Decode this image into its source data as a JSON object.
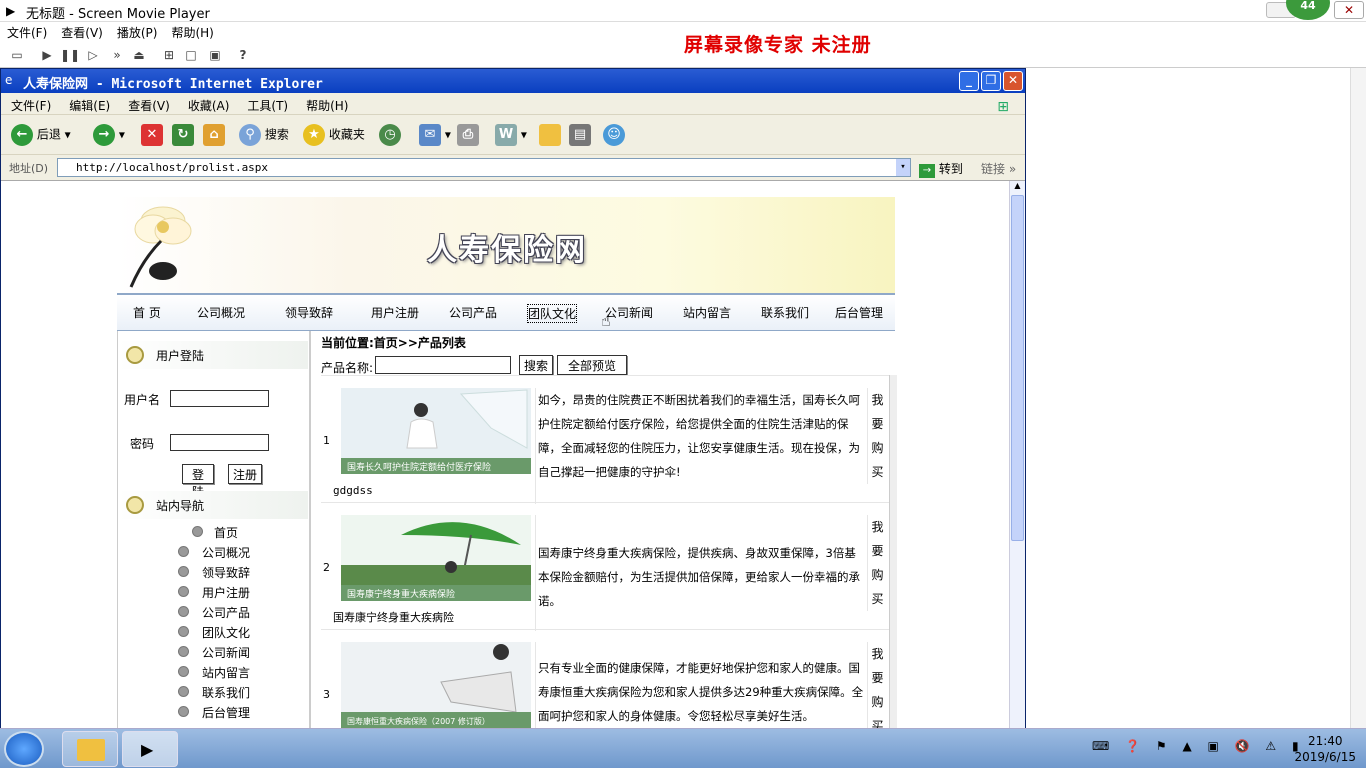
{
  "player": {
    "title": "无标题 - Screen Movie Player",
    "menu": [
      "文件(F)",
      "查看(V)",
      "播放(P)",
      "帮助(H)"
    ],
    "watermark": "屏幕录像专家  未注册",
    "badge": "44"
  },
  "ie": {
    "title": "人寿保险网 - Microsoft Internet Explorer",
    "menu": [
      "文件(F)",
      "编辑(E)",
      "查看(V)",
      "收藏(A)",
      "工具(T)",
      "帮助(H)"
    ],
    "toolbar": {
      "back": "后退",
      "search": "搜索",
      "favorites": "收藏夹"
    },
    "address_label": "地址(D)",
    "url": "http://localhost/prolist.aspx",
    "go": "转到",
    "links": "链接"
  },
  "site": {
    "title": "人寿保险网",
    "nav": [
      "首 页",
      "公司概况",
      "领导致辞",
      "用户注册",
      "公司产品",
      "团队文化",
      "公司新闻",
      "站内留言",
      "联系我们",
      "后台管理"
    ],
    "login": {
      "heading": "用户登陆",
      "username_label": "用户名",
      "password_label": "密码",
      "login_button": "登陆",
      "register_button": "注册"
    },
    "sitenav": {
      "heading": "站内导航",
      "items": [
        "首页",
        "公司概况",
        "领导致辞",
        "用户注册",
        "公司产品",
        "团队文化",
        "公司新闻",
        "站内留言",
        "联系我们",
        "后台管理"
      ]
    },
    "breadcrumb": "当前位置:首页>>产品列表",
    "search": {
      "label": "产品名称:",
      "button": "搜索",
      "all_button": "全部预览"
    },
    "products": [
      {
        "num": "1",
        "name": "gdgdss",
        "desc": "如今，昂贵的住院费正不断困扰着我们的幸福生活，国寿长久呵护住院定额给付医疗保险，给您提供全面的住院生活津贴的保障，全面减轻您的住院压力，让您安享健康生活。现在投保，为自己撑起一把健康的守护伞!",
        "buy": "我要购买",
        "img_caption": "国寿长久呵护住院定额给付医疗保险"
      },
      {
        "num": "2",
        "name": "国寿康宁终身重大疾病险",
        "desc": "国寿康宁终身重大疾病保险，提供疾病、身故双重保障，3倍基本保险金额赔付，为生活提供加倍保障，更给家人一份幸福的承诺。",
        "buy": "我要购买",
        "img_caption": "国寿康宁终身重大疾病保险"
      },
      {
        "num": "3",
        "name": "",
        "desc": "只有专业全面的健康保障，才能更好地保护您和家人的健康。国寿康恒重大疾病保险为您和家人提供多达29种重大疾病保障。全面呵护您和家人的身体健康。令您轻松尽享美好生活。",
        "buy": "我要购买",
        "img_caption": "国寿康恒重大疾病保险（2007 修订版）"
      }
    ]
  },
  "taskbar": {
    "time": "21:40",
    "date": "2019/6/15"
  }
}
